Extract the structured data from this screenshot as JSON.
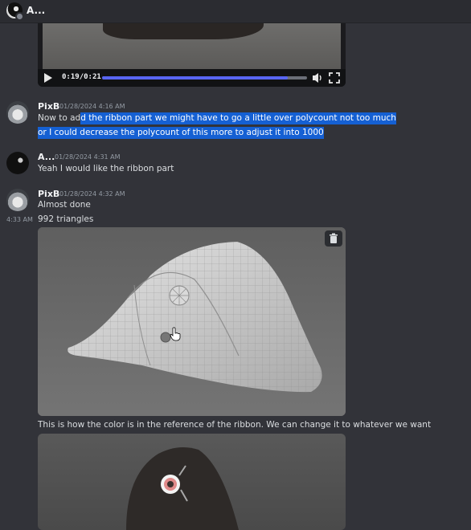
{
  "topbar": {
    "channel_name": "A...",
    "avatar_icon": "user-avatar-icon"
  },
  "video": {
    "current_time": "0:19",
    "separator": "/",
    "duration": "0:21",
    "progress_fraction": 0.905,
    "accent": "#5865f2"
  },
  "messages": [
    {
      "author": "PixB",
      "timestamp": "01/28/2024 4:16 AM",
      "lines": [
        {
          "plain": "Now to ad",
          "selected": "d the ribbon part we might have to go a little over polycount not too much"
        },
        {
          "selected": "or I could decrease the polycount of this more to adjust it into 1000"
        }
      ]
    },
    {
      "author": "A...",
      "timestamp": "01/28/2024 4:31 AM",
      "lines": [
        {
          "plain": "Yeah I would like the ribbon part"
        }
      ]
    },
    {
      "author": "PixB",
      "timestamp": "01/28/2024 4:32 AM",
      "lines": [
        {
          "plain": "Almost done"
        }
      ]
    }
  ],
  "followup": {
    "side_time": "4:33 AM",
    "text": "992 triangles"
  },
  "attachment_caption": "This is how the color is in the reference of the ribbon. We can change it to whatever we want",
  "colors": {
    "selection": "#1560d3",
    "background": "#323339"
  }
}
